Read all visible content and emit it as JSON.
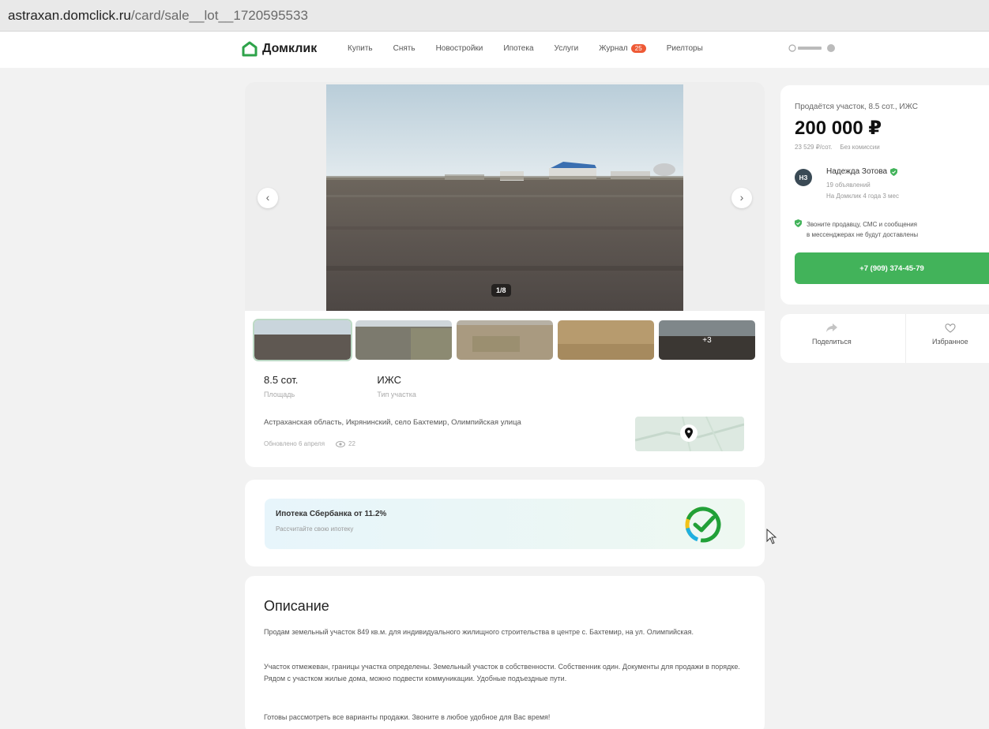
{
  "browser": {
    "url_host": "astraxan.domclick.ru",
    "url_path": "/card/sale__lot__1720595533"
  },
  "header": {
    "logo": "Домклик",
    "nav": [
      {
        "label": "Купить"
      },
      {
        "label": "Снять"
      },
      {
        "label": "Новостройки"
      },
      {
        "label": "Ипотека"
      },
      {
        "label": "Услуги"
      },
      {
        "label": "Журнал",
        "badge": "25"
      },
      {
        "label": "Риелторы"
      }
    ],
    "partner_icons": [
      "sber-partner-logo",
      "info-circle-icon"
    ]
  },
  "gallery": {
    "counter": "1/8",
    "more_label": "+3",
    "prev_icon": "chevron-left-icon",
    "next_icon": "chevron-right-icon"
  },
  "facts": [
    {
      "value": "8.5 сот.",
      "label": "Площадь"
    },
    {
      "value": "ИЖС",
      "label": "Тип участка"
    }
  ],
  "address": "Астраханская область, Икрянинский, село Бахтемир, Олимпийская улица",
  "meta": {
    "updated": "Обновлено 6 апреля",
    "views": "22"
  },
  "mortgage": {
    "title": "Ипотека Сбербанка от 11.2%",
    "subtitle": "Рассчитайте свою ипотеку"
  },
  "description": {
    "heading": "Описание",
    "paragraphs": [
      "Продам земельный участок 849 кв.м. для индивидуального жилищного строительства в центре с. Бахтемир, на ул. Олимпийская.",
      "Участок отмежеван, границы участка определены. Земельный участок в собственности. Собственник один. Документы для продажи в порядке. Рядом с участком жилые дома, можно подвести коммуникации. Удобные подъездные пути.",
      "Готовы рассмотреть все варианты продажи. Звоните в любое удобное для Вас время!"
    ]
  },
  "sidebar": {
    "title": "Продаётся участок, 8.5 сот., ИЖС",
    "price": "200 000 ₽",
    "price_per_unit": "23 529 ₽/сот.",
    "commission": "Без комиссии",
    "seller": {
      "initials": "НЗ",
      "name": "Надежда Зотова",
      "listings": "19 объявлений",
      "since": "На Домклик 4 года 3 мес"
    },
    "notice_line1": "Звоните продавцу, СМС и сообщения",
    "notice_line2": "в мессенджерах не будут доставлены",
    "phone": "+7 (909) 374-45-79"
  },
  "actions": {
    "share": "Поделиться",
    "favorite": "Избранное"
  },
  "colors": {
    "brand_green": "#42b35a",
    "badge_orange": "#ee5a36"
  }
}
